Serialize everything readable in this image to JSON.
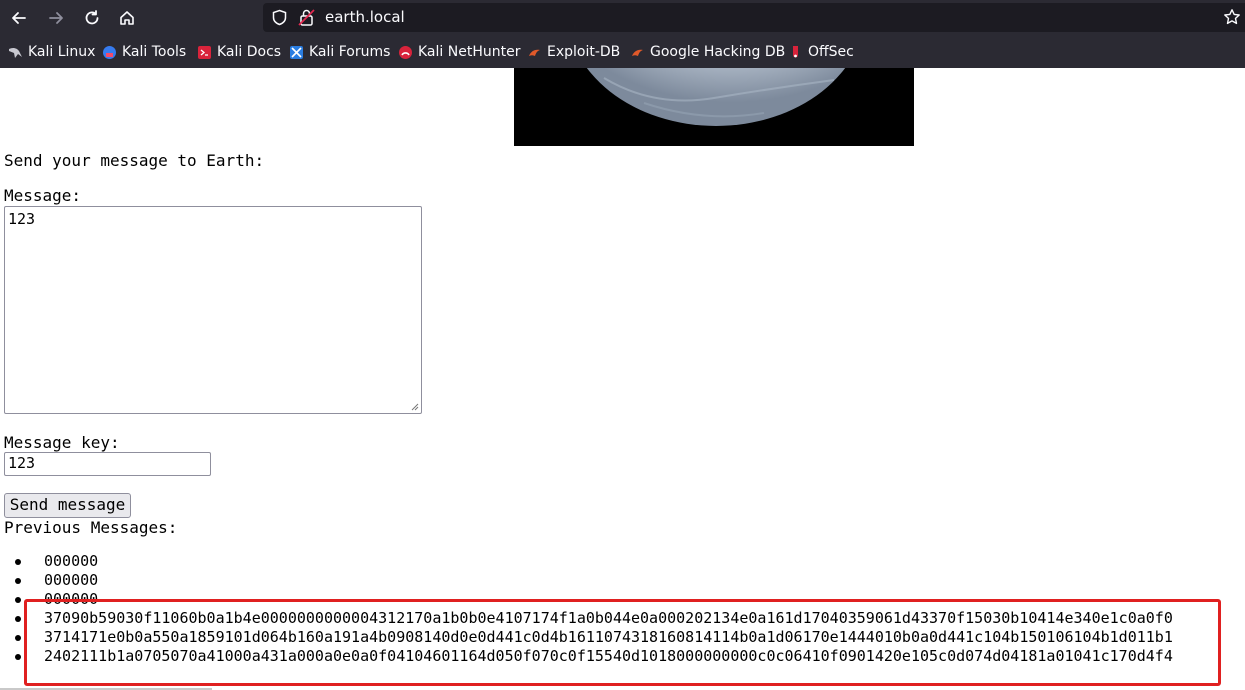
{
  "browser": {
    "url": "earth.local",
    "bookmarks": [
      {
        "label": "Kali Linux",
        "icon": "kali-dragon-icon"
      },
      {
        "label": "Kali Tools",
        "icon": "kali-tools-icon"
      },
      {
        "label": "Kali Docs",
        "icon": "kali-docs-icon"
      },
      {
        "label": "Kali Forums",
        "icon": "kali-forums-icon"
      },
      {
        "label": "Kali NetHunter",
        "icon": "kali-nethunter-icon"
      },
      {
        "label": "Exploit-DB",
        "icon": "exploit-db-icon"
      },
      {
        "label": "Google Hacking DB",
        "icon": "ghdb-icon"
      },
      {
        "label": "OffSec",
        "icon": "offsec-icon"
      }
    ]
  },
  "page": {
    "intro": "Send your message to Earth:",
    "message_label": "Message:",
    "message_value": "123",
    "key_label": "Message key:",
    "key_value": "123",
    "send_button": "Send message",
    "previous_label": "Previous Messages:",
    "messages": [
      "000000",
      "000000",
      "000000",
      "37090b59030f11060b0a1b4e0000000000004312170a1b0b0e4107174f1a0b044e0a000202134e0a161d17040359061d43370f15030b10414e340e1c0a0f0",
      "3714171e0b0a550a1859101d064b160a191a4b0908140d0e0d441c0d4b1611074318160814114b0a1d06170e1444010b0a0d441c104b150106104b1d011b1",
      "2402111b1a0705070a41000a431a000a0e0a0f04104601164d050f070c0f15540d1018000000000c0c06410f0901420e105c0d074d04181a01041c170d4f4"
    ]
  },
  "colors": {
    "chrome": "#2b2a33",
    "urlbar": "#1c1b22",
    "highlight": "#e02020"
  }
}
